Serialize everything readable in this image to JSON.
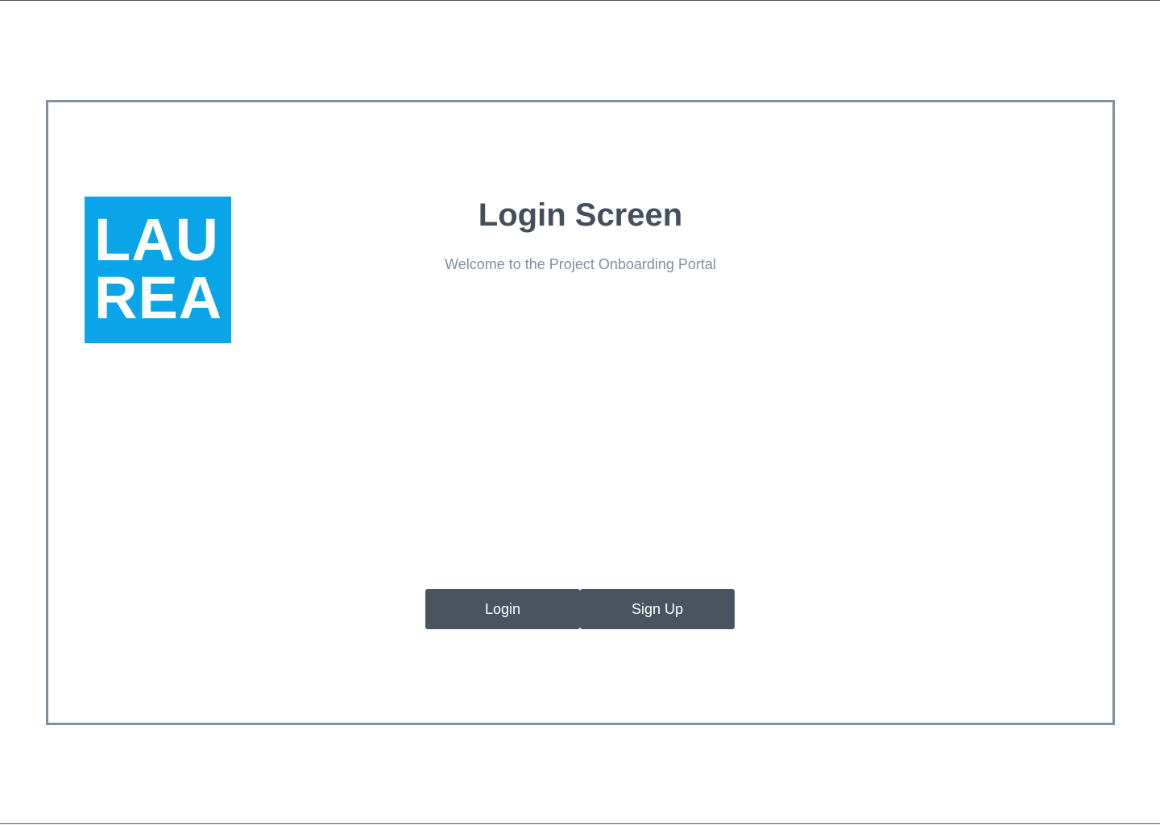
{
  "logo": {
    "lines": [
      "LAU",
      "REA"
    ],
    "background_color": "#0aa5e8"
  },
  "header": {
    "title": "Login Screen",
    "subtitle": "Welcome to the Project Onboarding Portal"
  },
  "actions": {
    "login_label": "Login",
    "signup_label": "Sign Up"
  },
  "colors": {
    "frame_border": "#7f8fa0",
    "button_bg": "#4a5360",
    "title_text": "#454f5c",
    "subtitle_text": "#7f8fa0"
  }
}
